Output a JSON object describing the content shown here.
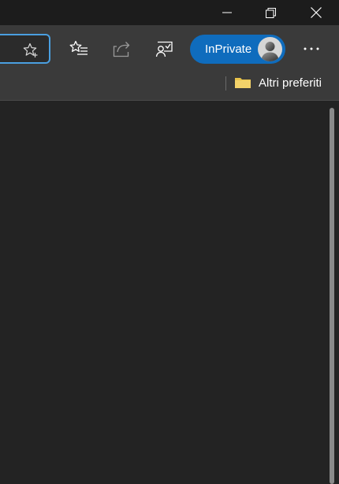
{
  "window": {
    "minimize_icon": "minimize-icon",
    "restore_icon": "restore-icon",
    "close_icon": "close-icon"
  },
  "toolbar": {
    "address_star_icon": "favorite-star-icon",
    "buttons": [
      {
        "icon": "favorites-list-icon"
      },
      {
        "icon": "share-icon"
      },
      {
        "icon": "feedback-icon"
      }
    ],
    "inprivate_label": "InPrivate",
    "more_icon": "more-dots-icon"
  },
  "favorites_bar": {
    "folder_icon": "folder-icon",
    "other_favorites_label": "Altri preferiti"
  },
  "colors": {
    "accent": "#0f6cbd",
    "address_focus": "#4a9fe0",
    "background": "#232323",
    "toolbar": "#3a3a3a",
    "folder": "#e8c34a"
  }
}
